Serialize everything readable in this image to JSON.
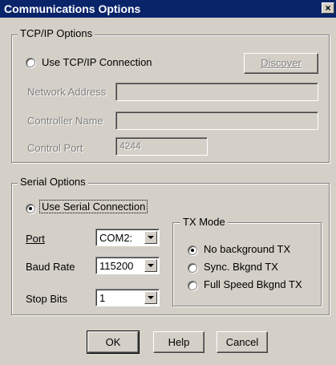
{
  "window": {
    "title": "Communications Options",
    "close_glyph": "×"
  },
  "tcpip": {
    "group_label": "TCP/IP Options",
    "use_label": "Use TCP/IP Connection",
    "selected": false,
    "discover_label": "Discover",
    "network_address_label": "Network Address",
    "network_address_value": "",
    "controller_name_label": "Controller Name",
    "controller_name_value": "",
    "control_port_label": "Control Port",
    "control_port_value": "4244"
  },
  "serial": {
    "group_label": "Serial Options",
    "use_label": "Use Serial Connection",
    "selected": true,
    "port_label": "Port",
    "port_value": "COM2:",
    "baud_label": "Baud Rate",
    "baud_value": "115200",
    "stop_bits_label": "Stop Bits",
    "stop_bits_value": "1"
  },
  "tx_mode": {
    "group_label": "TX Mode",
    "options": [
      {
        "label": "No background TX",
        "selected": true
      },
      {
        "label": "Sync. Bkgnd TX",
        "selected": false
      },
      {
        "label": "Full Speed Bkgnd TX",
        "selected": false
      }
    ]
  },
  "buttons": {
    "ok": "OK",
    "help": "Help",
    "cancel": "Cancel"
  },
  "colors": {
    "title_bar": "#0a246a",
    "face": "#d4d0c8"
  }
}
